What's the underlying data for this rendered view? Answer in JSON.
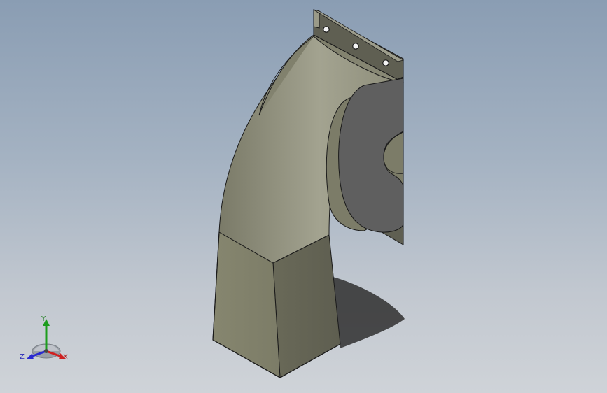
{
  "viewport": {
    "background_top": "#8a9db3",
    "background_bottom": "#cfd3d8",
    "model_color": "#8e8e7a",
    "model_shadow_color": "#5c5c5c"
  },
  "triad": {
    "axes": [
      {
        "label": "Y",
        "color": "#1d9d1d"
      },
      {
        "label": "X",
        "color": "#d02020"
      },
      {
        "label": "Z",
        "color": "#2a2ad0"
      }
    ]
  }
}
